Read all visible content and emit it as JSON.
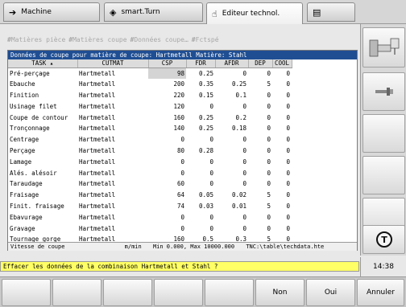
{
  "tabs": [
    {
      "label": "Machine",
      "icon": "arrow-right-icon"
    },
    {
      "label": "smart.Turn",
      "icon": "diamond-arrows-icon"
    },
    {
      "label": "Editeur technol.",
      "icon": "hand-icon"
    },
    {
      "label": "",
      "icon": "save-icon"
    }
  ],
  "toolbar": {
    "items": [
      "Matières pièce",
      "Matières coupe",
      "Données coupe…",
      "Fctspé"
    ]
  },
  "panel": {
    "title": "Données de coupe pour matière de coupe: Hartmetall   Matière: Stahl",
    "columns": [
      "TASK",
      "CUTMAT",
      "CSP",
      "FDR",
      "AFDR",
      "DEP",
      "COOL"
    ],
    "rows": [
      [
        "Pré-perçage",
        "Hartmetall",
        "98",
        "0.25",
        "0",
        "0",
        "0"
      ],
      [
        "Ebauche",
        "Hartmetall",
        "200",
        "0.35",
        "0.25",
        "5",
        "0"
      ],
      [
        "Finition",
        "Hartmetall",
        "220",
        "0.15",
        "0.1",
        "0",
        "0"
      ],
      [
        "Usinage filet",
        "Hartmetall",
        "120",
        "0",
        "0",
        "0",
        "0"
      ],
      [
        "Coupe de contour",
        "Hartmetall",
        "160",
        "0.25",
        "0.2",
        "0",
        "0"
      ],
      [
        "Tronçonnage",
        "Hartmetall",
        "140",
        "0.25",
        "0.18",
        "0",
        "0"
      ],
      [
        "Centrage",
        "Hartmetall",
        "0",
        "0",
        "0",
        "0",
        "0"
      ],
      [
        "Perçage",
        "Hartmetall",
        "80",
        "0.28",
        "0",
        "0",
        "0"
      ],
      [
        "Lamage",
        "Hartmetall",
        "0",
        "0",
        "0",
        "0",
        "0"
      ],
      [
        "Alés. alésoir",
        "Hartmetall",
        "0",
        "0",
        "0",
        "0",
        "0"
      ],
      [
        "Taraudage",
        "Hartmetall",
        "60",
        "0",
        "0",
        "0",
        "0"
      ],
      [
        "Fraisage",
        "Hartmetall",
        "64",
        "0.05",
        "0.02",
        "5",
        "0"
      ],
      [
        "Finit. fraisage",
        "Hartmetall",
        "74",
        "0.03",
        "0.01",
        "5",
        "0"
      ],
      [
        "Ebavurage",
        "Hartmetall",
        "0",
        "0",
        "0",
        "0",
        "0"
      ],
      [
        "Gravage",
        "Hartmetall",
        "0",
        "0",
        "0",
        "0",
        "0"
      ],
      [
        "Tournage gorge",
        "Hartmetall",
        "160",
        "0.5",
        "0.3",
        "5",
        "0"
      ]
    ]
  },
  "status": {
    "field": "Vitesse de coupe",
    "unit": "m/min",
    "range": "Min 0.000, Max 10000.000",
    "file": "TNC:\\table\\techdata.hte"
  },
  "message": "Effacer les données de la combinaison Hartmetall et Stahl ?",
  "clock": "14:38",
  "softkeys": {
    "non": "Non",
    "oui": "Oui",
    "annuler": "Annuler"
  },
  "colors": {
    "title_bar": "#1f4e93",
    "message_bar": "#ffff66",
    "highlight": "#7fa6d8"
  }
}
